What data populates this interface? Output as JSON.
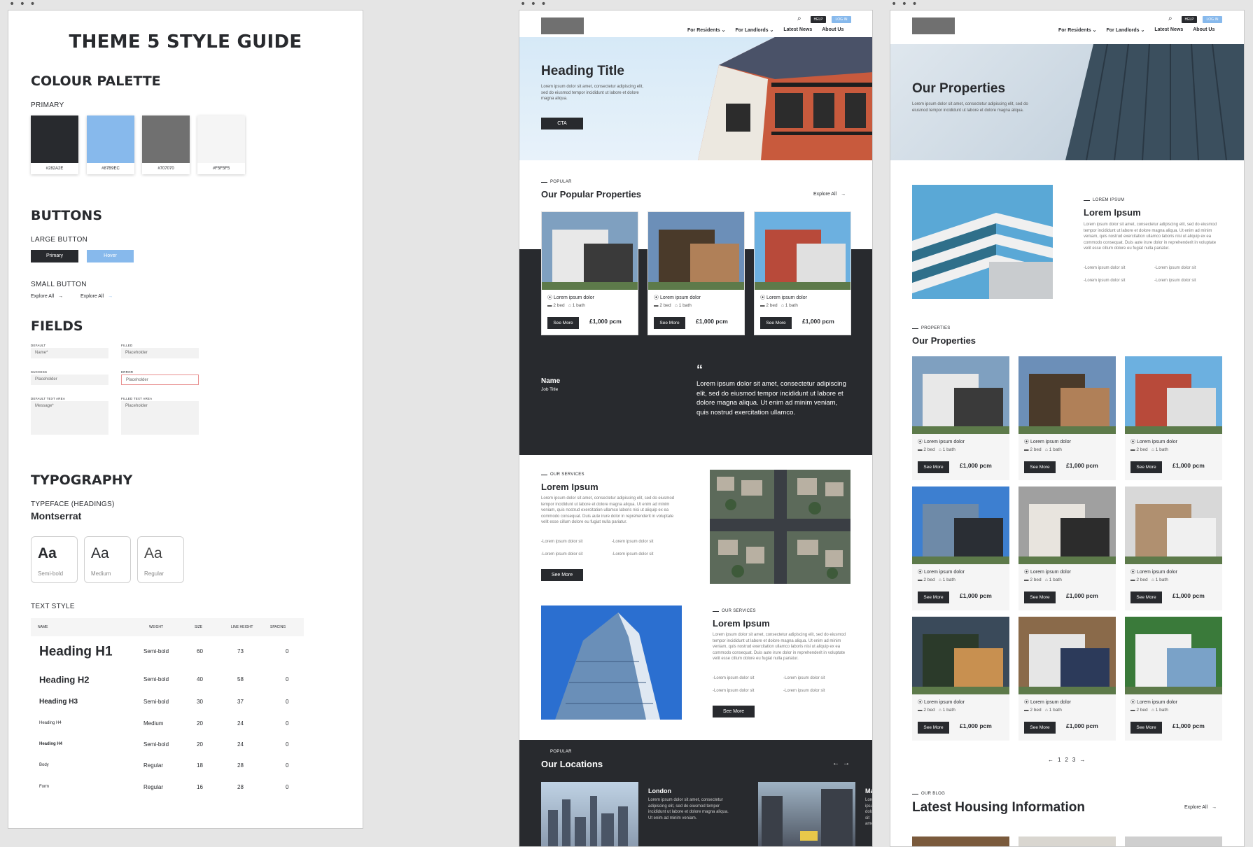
{
  "styleguide": {
    "title": "THEME 5 STYLE GUIDE",
    "colour_heading": "COLOUR PALETTE",
    "primary_label": "PRIMARY",
    "swatches": [
      {
        "hex": "#282A2E",
        "color": "#282a2e"
      },
      {
        "hex": "#87B9EC",
        "color": "#87b9ec"
      },
      {
        "hex": "#707070",
        "color": "#707070"
      },
      {
        "hex": "#F5F5F5",
        "color": "#f5f5f5"
      }
    ],
    "buttons_heading": "BUTTONS",
    "large_button_label": "LARGE BUTTON",
    "primary_btn": "Primary",
    "hover_btn": "Hover",
    "small_button_label": "SMALL BUTTON",
    "explore_all": "Explore All",
    "fields_heading": "FIELDS",
    "fields": {
      "default_label": "DEFAULT",
      "default_ph": "Name*",
      "filled_label": "FILLED",
      "filled_ph": "Placeholder",
      "success_label": "SUCCESS",
      "success_ph": "Placeholder",
      "error_label": "ERROR",
      "error_ph": "Placeholder",
      "default_ta_label": "DEFAULT TEXT AREA",
      "default_ta_ph": "Message*",
      "filled_ta_label": "FILLED TEXT AREA",
      "filled_ta_ph": "Placeholder"
    },
    "typography_heading": "TYPOGRAPHY",
    "typeface_label": "TYPEFACE (HEADINGS)",
    "typeface_name": "Montserrat",
    "samples": [
      {
        "aa": "Aa",
        "weight": "Semi-bold"
      },
      {
        "aa": "Aa",
        "weight": "Medium"
      },
      {
        "aa": "Aa",
        "weight": "Regular"
      }
    ],
    "text_style_label": "TEXT STYLE",
    "table_cols": [
      "NAME",
      "WEIGHT",
      "SIZE",
      "LINE HEIGHT",
      "SPACING"
    ],
    "table_rows": [
      {
        "name": "Heading H1",
        "weight": "Semi-bold",
        "size": "60",
        "lh": "73",
        "sp": "0"
      },
      {
        "name": "Heading H2",
        "weight": "Semi-bold",
        "size": "40",
        "lh": "58",
        "sp": "0"
      },
      {
        "name": "Heading H3",
        "weight": "Semi-bold",
        "size": "30",
        "lh": "37",
        "sp": "0"
      },
      {
        "name": "Heading H4",
        "weight": "Medium",
        "size": "20",
        "lh": "24",
        "sp": "0"
      },
      {
        "name": "Heading H4",
        "weight": "Semi-bold",
        "size": "20",
        "lh": "24",
        "sp": "0"
      },
      {
        "name": "Body",
        "weight": "Regular",
        "size": "18",
        "lh": "28",
        "sp": "0"
      },
      {
        "name": "Form",
        "weight": "Regular",
        "size": "16",
        "lh": "28",
        "sp": "0"
      }
    ]
  },
  "header": {
    "help": "HELP",
    "login": "LOG IN",
    "nav": [
      "For Residents",
      "For Landlords",
      "Latest News",
      "About Us"
    ]
  },
  "home": {
    "hero_title": "Heading Title",
    "hero_text": "Lorem ipsum dolor sit amet, consectetur adipiscing elit, sed do eiusmod tempor incididunt ut labore et dolore magna aliqua.",
    "cta": "CTA",
    "popular_eyebrow": "POPULAR",
    "popular_title": "Our Popular Properties",
    "explore_all": "Explore All",
    "card": {
      "loc": "Lorem ipsum dolor",
      "bed": "2 bed",
      "bath": "1 bath",
      "see": "See More",
      "price": "£1,000 pcm"
    },
    "testimonial_name": "Name",
    "testimonial_job": "Job Title",
    "quote_mark": "“",
    "quote": "Lorem ipsum dolor sit amet, consectetur adipiscing elit, sed do eiusmod tempor incididunt ut labore et dolore magna aliqua. Ut enim ad minim veniam, quis nostrud exercitation ullamco.",
    "services_eyebrow": "OUR SERVICES",
    "services_title": "Lorem Ipsum",
    "services_text": "Lorem ipsum dolor sit amet, consectetur adipiscing elit, sed do eiusmod tempor incididunt ut labore et dolore magna aliqua. Ut enim ad minim veniam, quis nostrud exercitation ullamco laboris nisi ut aliquip ex ea commodo consequat. Duis aute irure dolor in reprehenderit in voluptate velit esse cillum dolore eu fugiat nulla pariatur.",
    "bullet": "Lorem ipsum dolor sit",
    "see_more": "See More",
    "locations_eyebrow": "POPULAR",
    "locations_title": "Our Locations",
    "location_name": "London",
    "location_text": "Lorem ipsum dolor sit amet, consectetur adipiscing elit, sed do eiusmod tempor incididunt ut labore et dolore magna aliqua. Ut enim ad minim veniam.",
    "location2_partial": "Ma"
  },
  "properties": {
    "hero_title": "Our Properties",
    "hero_text": "Lorem ipsum dolor sit amet, consectetur adipiscing elit, sed do eiusmod tempor incididunt ut labore et dolore magna aliqua.",
    "intro_eyebrow": "LOREM IPSUM",
    "intro_title": "Lorem Ipsum",
    "intro_text": "Lorem ipsum dolor sit amet, consectetur adipiscing elit, sed do eiusmod tempor incididunt ut labore et dolore magna aliqua. Ut enim ad minim veniam, quis nostrud exercitation ullamco laboris nisi ut aliquip ex ea commodo consequat. Duis aute irure dolor in reprehenderit in voluptate velit esse cillum dolore eu fugiat nulla pariatur.",
    "list_eyebrow": "PROPERTIES",
    "list_title": "Our Properties",
    "pagination": [
      "1",
      "2",
      "3"
    ],
    "blog_eyebrow": "OUR BLOG",
    "blog_title": "Latest Housing Information",
    "explore_all": "Explore All"
  }
}
